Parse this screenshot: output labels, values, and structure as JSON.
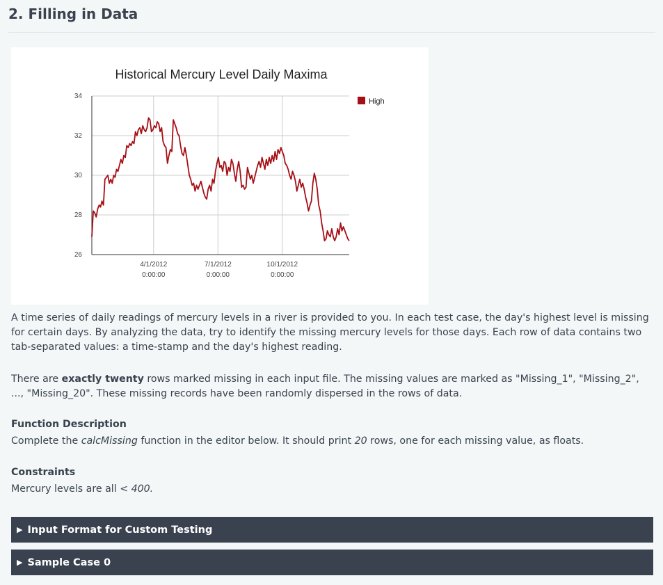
{
  "heading": "2. Filling in Data",
  "chart_data": {
    "type": "line",
    "title": "Historical Mercury Level Daily Maxima",
    "legend": {
      "label": "High",
      "placement": "top-right"
    },
    "color": "#a50f15",
    "ylim": [
      26,
      34
    ],
    "yticks": [
      34,
      32,
      30,
      28,
      26
    ],
    "xticks": [
      {
        "line1": "4/1/2012",
        "line2": "0:00:00"
      },
      {
        "line1": "7/1/2012",
        "line2": "0:00:00"
      },
      {
        "line1": "10/1/2012",
        "line2": "0:00:00"
      }
    ],
    "grid": true,
    "series": [
      {
        "name": "High",
        "x_range": [
          "2012-01-03",
          "2013-01-01"
        ],
        "values": [
          26.9,
          28.2,
          28.1,
          27.9,
          28.3,
          28.5,
          28.4,
          28.7,
          28.5,
          29.8,
          29.9,
          30.0,
          29.6,
          29.8,
          29.6,
          30.0,
          29.9,
          30.3,
          30.2,
          30.5,
          30.8,
          30.6,
          31.0,
          30.9,
          31.5,
          31.4,
          31.6,
          31.5,
          31.7,
          31.6,
          32.2,
          32.0,
          32.3,
          32.4,
          32.1,
          32.5,
          32.3,
          32.2,
          32.4,
          32.9,
          32.8,
          32.2,
          32.3,
          32.5,
          32.4,
          32.7,
          32.6,
          32.2,
          32.4,
          31.7,
          31.5,
          31.4,
          30.6,
          31.0,
          31.3,
          31.2,
          32.8,
          32.6,
          32.4,
          32.1,
          32.0,
          31.5,
          31.1,
          31.0,
          31.4,
          31.0,
          30.5,
          30.0,
          29.8,
          29.5,
          29.6,
          29.2,
          29.5,
          29.3,
          29.5,
          29.7,
          29.4,
          29.1,
          28.9,
          28.8,
          29.3,
          29.5,
          29.2,
          29.8,
          29.6,
          30.2,
          30.6,
          30.9,
          30.4,
          30.5,
          30.2,
          30.7,
          30.6,
          30.0,
          30.4,
          30.2,
          30.8,
          30.6,
          30.1,
          29.7,
          30.3,
          30.7,
          30.2,
          29.4,
          29.5,
          29.3,
          29.4,
          30.4,
          30.1,
          29.8,
          30.0,
          29.6,
          29.9,
          30.2,
          30.5,
          30.7,
          30.4,
          30.9,
          30.6,
          30.3,
          30.8,
          30.5,
          30.9,
          30.6,
          31.0,
          30.7,
          31.2,
          30.8,
          31.3,
          31.1,
          31.4,
          31.2,
          31.0,
          30.6,
          30.5,
          30.3,
          30.0,
          29.8,
          30.2,
          30.0,
          29.7,
          29.2,
          29.5,
          29.8,
          29.4,
          29.6,
          29.3,
          28.9,
          28.6,
          28.2,
          28.5,
          28.7,
          29.6,
          30.1,
          29.8,
          29.3,
          28.5,
          28.2,
          27.6,
          27.2,
          26.7,
          26.8,
          27.2,
          27.0,
          26.9,
          27.3,
          26.9,
          26.7,
          26.9,
          27.3,
          27.0,
          27.6,
          27.2,
          27.4,
          27.2,
          27.0,
          26.8,
          26.7
        ]
      }
    ]
  },
  "intro": "A time series of daily readings of mercury levels in a river is provided to you. In each test case, the day's highest level is missing for certain days. By analyzing the data, try to identify the missing mercury levels for those days. Each row of data contains two tab-separated values: a time-stamp and the day's highest reading.",
  "missing": {
    "pre": "There are ",
    "bold": "exactly twenty",
    "post": " rows marked missing in each input file. The missing values are marked as \"Missing_1\", \"Missing_2\", ..., \"Missing_20\". These missing records have been randomly dispersed in the rows of data."
  },
  "function_description": {
    "title": "Function Description",
    "pre": "Complete the ",
    "func": "calcMissing",
    "mid": " function in the editor below. It should print ",
    "count": "20",
    "post": " rows, one for each missing value, as floats."
  },
  "constraints": {
    "title": "Constraints",
    "pre": "Mercury levels are all ",
    "value": "< 400."
  },
  "accordions": [
    {
      "label": "Input Format for Custom Testing"
    },
    {
      "label": "Sample Case 0"
    }
  ]
}
